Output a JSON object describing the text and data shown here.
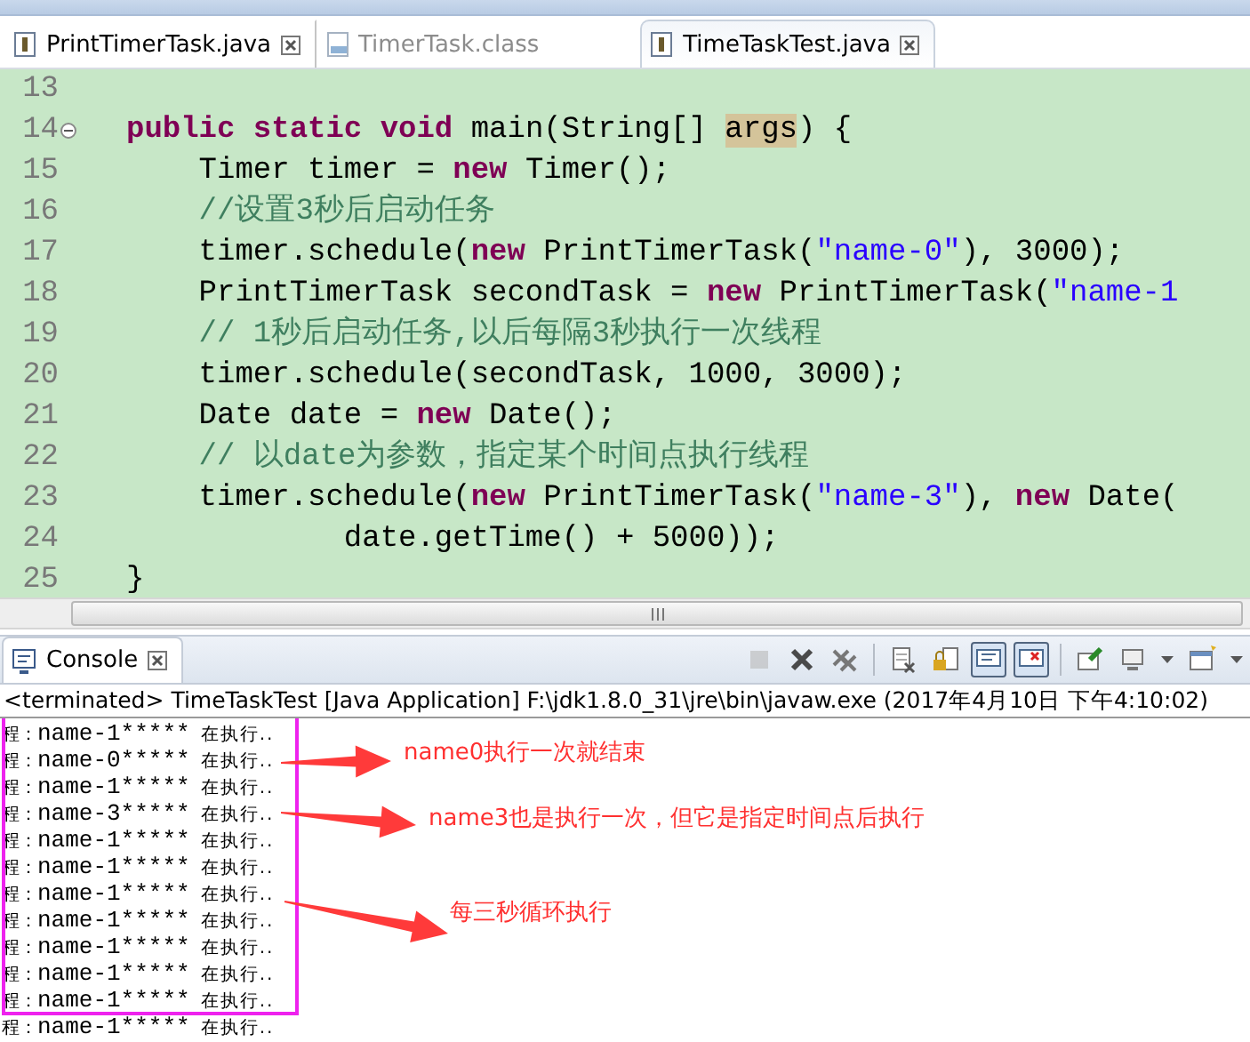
{
  "editor_tabs": [
    {
      "label": "PrintTimerTask.java",
      "kind": "java",
      "selected": false,
      "closable": true
    },
    {
      "label": "TimerTask.class",
      "kind": "class",
      "selected": false,
      "closable": false
    },
    {
      "label": "TimeTaskTest.java",
      "kind": "java",
      "selected": true,
      "closable": true
    }
  ],
  "code_lines": [
    {
      "number": "13",
      "foldable": false
    },
    {
      "number": "14",
      "foldable": true,
      "segments": [
        {
          "kind": "keyword",
          "text": "public static void"
        },
        {
          "kind": "plain",
          "text": " main(String[] "
        },
        {
          "kind": "marked",
          "text": "args"
        },
        {
          "kind": "plain",
          "text": ") {"
        }
      ]
    },
    {
      "number": "15",
      "foldable": false,
      "segments": [
        {
          "kind": "plain",
          "text": "    Timer timer = "
        },
        {
          "kind": "keyword",
          "text": "new"
        },
        {
          "kind": "plain",
          "text": " Timer();"
        }
      ]
    },
    {
      "number": "16",
      "foldable": false,
      "segments": [
        {
          "kind": "comment",
          "text": "    //设置3秒后启动任务"
        }
      ]
    },
    {
      "number": "17",
      "foldable": false,
      "segments": [
        {
          "kind": "plain",
          "text": "    timer.schedule("
        },
        {
          "kind": "keyword",
          "text": "new"
        },
        {
          "kind": "plain",
          "text": " PrintTimerTask("
        },
        {
          "kind": "string",
          "text": "\"name-0\""
        },
        {
          "kind": "plain",
          "text": "), 3000);"
        }
      ]
    },
    {
      "number": "18",
      "foldable": false,
      "segments": [
        {
          "kind": "plain",
          "text": "    PrintTimerTask secondTask = "
        },
        {
          "kind": "keyword",
          "text": "new"
        },
        {
          "kind": "plain",
          "text": " PrintTimerTask("
        },
        {
          "kind": "string",
          "text": "\"name-1"
        }
      ]
    },
    {
      "number": "19",
      "foldable": false,
      "segments": [
        {
          "kind": "comment",
          "text": "    // 1秒后启动任务,以后每隔3秒执行一次线程"
        }
      ]
    },
    {
      "number": "20",
      "foldable": false,
      "segments": [
        {
          "kind": "plain",
          "text": "    timer.schedule(secondTask, 1000, 3000);"
        }
      ]
    },
    {
      "number": "21",
      "foldable": false,
      "segments": [
        {
          "kind": "plain",
          "text": "    Date date = "
        },
        {
          "kind": "keyword",
          "text": "new"
        },
        {
          "kind": "plain",
          "text": " Date();"
        }
      ]
    },
    {
      "number": "22",
      "foldable": false,
      "segments": [
        {
          "kind": "comment",
          "text": "    // 以date为参数，指定某个时间点执行线程"
        }
      ]
    },
    {
      "number": "23",
      "foldable": false,
      "segments": [
        {
          "kind": "plain",
          "text": "    timer.schedule("
        },
        {
          "kind": "keyword",
          "text": "new"
        },
        {
          "kind": "plain",
          "text": " PrintTimerTask("
        },
        {
          "kind": "string",
          "text": "\"name-3\""
        },
        {
          "kind": "plain",
          "text": "), "
        },
        {
          "kind": "keyword",
          "text": "new"
        },
        {
          "kind": "plain",
          "text": " Date("
        }
      ]
    },
    {
      "number": "24",
      "foldable": false,
      "segments": [
        {
          "kind": "plain",
          "text": "            date.getTime() + 5000));"
        }
      ]
    },
    {
      "number": "25",
      "foldable": false,
      "segments": [
        {
          "kind": "plain",
          "text": "}"
        }
      ]
    }
  ],
  "console": {
    "tab_label": "Console",
    "toolbar_groups": [
      [
        {
          "kind": "stop",
          "disabled": true,
          "pressed": false
        },
        {
          "kind": "remove",
          "disabled": false,
          "pressed": false
        },
        {
          "kind": "remove-all",
          "disabled": false,
          "pressed": false
        }
      ],
      [
        {
          "kind": "clear",
          "disabled": false,
          "pressed": false
        },
        {
          "kind": "lock",
          "disabled": false,
          "pressed": false
        },
        {
          "kind": "stdout",
          "disabled": false,
          "pressed": true
        },
        {
          "kind": "stderr",
          "disabled": false,
          "pressed": true
        }
      ],
      [
        {
          "kind": "pin",
          "disabled": false,
          "pressed": false
        },
        {
          "kind": "display",
          "disabled": false,
          "pressed": false
        },
        {
          "kind": "menu",
          "disabled": false,
          "pressed": false
        },
        {
          "kind": "new",
          "disabled": false,
          "pressed": false
        },
        {
          "kind": "menu",
          "disabled": false,
          "pressed": false
        }
      ]
    ],
    "status": "<terminated> TimeTaskTest [Java Application] F:\\jdk1.8.0_31\\jre\\bin\\javaw.exe (2017年4月10日 下午4:10:02)",
    "output": [
      {
        "prefix": "程：",
        "name": "name-1*****",
        "suffix": "在执行.."
      },
      {
        "prefix": "程：",
        "name": "name-0*****",
        "suffix": "在执行.."
      },
      {
        "prefix": "程：",
        "name": "name-1*****",
        "suffix": "在执行.."
      },
      {
        "prefix": "程：",
        "name": "name-3*****",
        "suffix": "在执行.."
      },
      {
        "prefix": "程：",
        "name": "name-1*****",
        "suffix": "在执行.."
      },
      {
        "prefix": "程：",
        "name": "name-1*****",
        "suffix": "在执行.."
      },
      {
        "prefix": "程：",
        "name": "name-1*****",
        "suffix": "在执行.."
      },
      {
        "prefix": "程：",
        "name": "name-1*****",
        "suffix": "在执行.."
      },
      {
        "prefix": "程：",
        "name": "name-1*****",
        "suffix": "在执行.."
      },
      {
        "prefix": "程：",
        "name": "name-1*****",
        "suffix": "在执行.."
      },
      {
        "prefix": "程：",
        "name": "name-1*****",
        "suffix": "在执行.."
      },
      {
        "prefix": "程：",
        "name": "name-1*****",
        "suffix": "在执行.."
      }
    ],
    "annotations": [
      {
        "text": "name0执行一次就结束"
      },
      {
        "text": "name3也是执行一次，但它是指定时间点后执行"
      },
      {
        "text": "每三秒循环执行"
      }
    ]
  }
}
